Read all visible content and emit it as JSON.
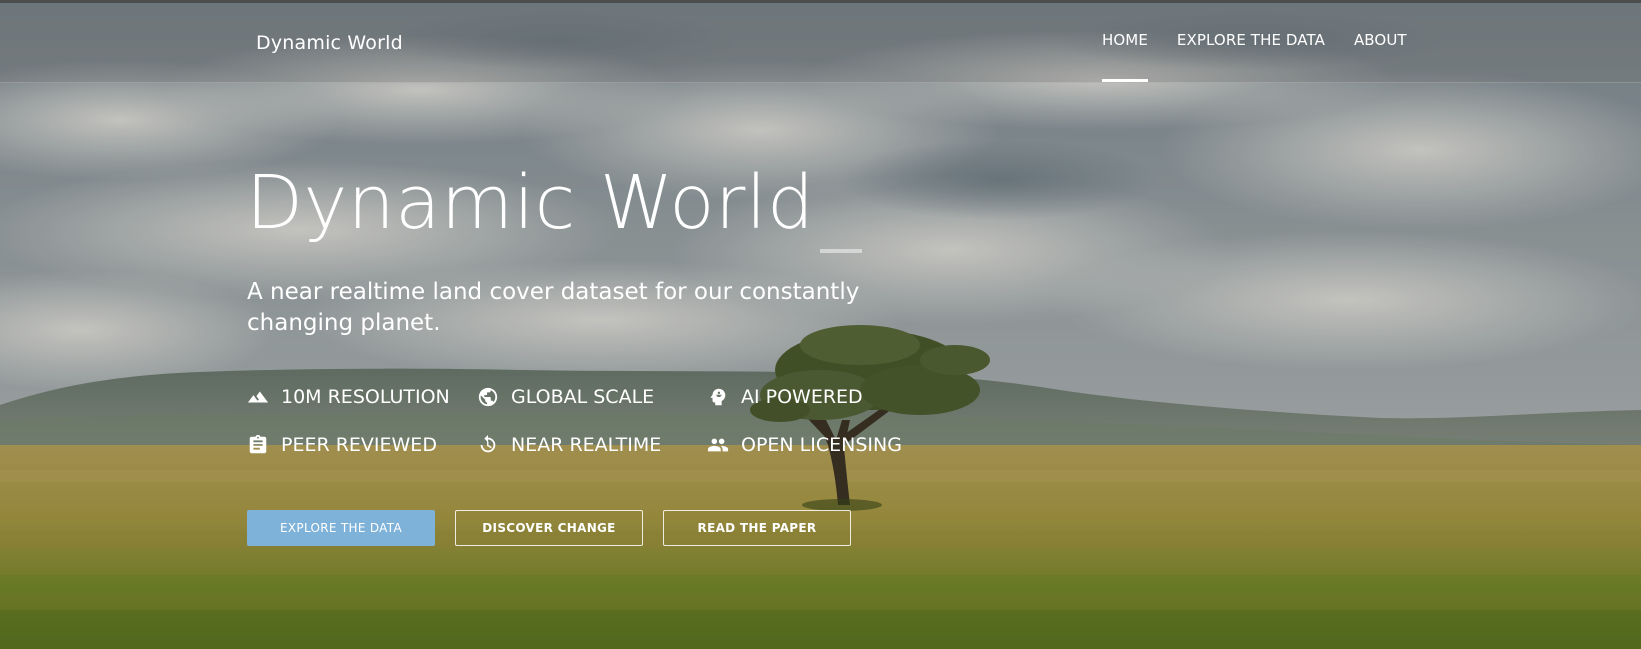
{
  "nav": {
    "brand": "Dynamic World",
    "items": [
      {
        "label": "HOME",
        "active": true
      },
      {
        "label": "EXPLORE THE DATA",
        "active": false
      },
      {
        "label": "ABOUT",
        "active": false
      }
    ]
  },
  "hero": {
    "title": "Dynamic World",
    "subtitle": "A near realtime land cover dataset for our constantly changing planet."
  },
  "features": [
    {
      "icon": "mountain-icon",
      "label": "10M RESOLUTION"
    },
    {
      "icon": "globe-icon",
      "label": "GLOBAL SCALE"
    },
    {
      "icon": "brain-head-icon",
      "label": "AI POWERED"
    },
    {
      "icon": "clipboard-icon",
      "label": "PEER REVIEWED"
    },
    {
      "icon": "refresh-clock-icon",
      "label": "NEAR REALTIME"
    },
    {
      "icon": "people-icon",
      "label": "OPEN LICENSING"
    }
  ],
  "buttons": {
    "explore": "EXPLORE THE DATA",
    "discover": "DISCOVER CHANGE",
    "paper": "READ THE PAPER"
  },
  "colors": {
    "primary_button": "#7fb2d9",
    "text": "#ffffff"
  }
}
